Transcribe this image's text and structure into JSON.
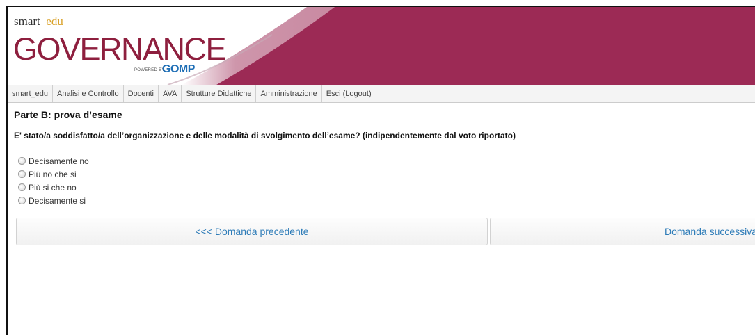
{
  "header": {
    "logo_small_prefix": "smart",
    "logo_small_us": "_",
    "logo_small_suffix": "edu",
    "logo_big": "GOVERNANCE",
    "powered_by": "POWERED BY",
    "gomp": "GOMP",
    "band_color": "#9c2a55"
  },
  "nav": {
    "items": [
      "smart_edu",
      "Analisi e Controllo",
      "Docenti",
      "AVA",
      "Strutture Didattiche",
      "Amministrazione",
      "Esci (Logout)"
    ]
  },
  "content": {
    "section_title": "Parte B: prova d’esame",
    "question": "E' stato/a soddisfatto/a dell’organizzazione e delle modalità di svolgimento dell’esame? (indipendentemente dal voto riportato)",
    "options": [
      "Decisamente no",
      "Più no che si",
      "Più si che no",
      "Decisamente si"
    ]
  },
  "buttons": {
    "prev": "<<< Domanda precedente",
    "next": "Domanda successiva"
  }
}
